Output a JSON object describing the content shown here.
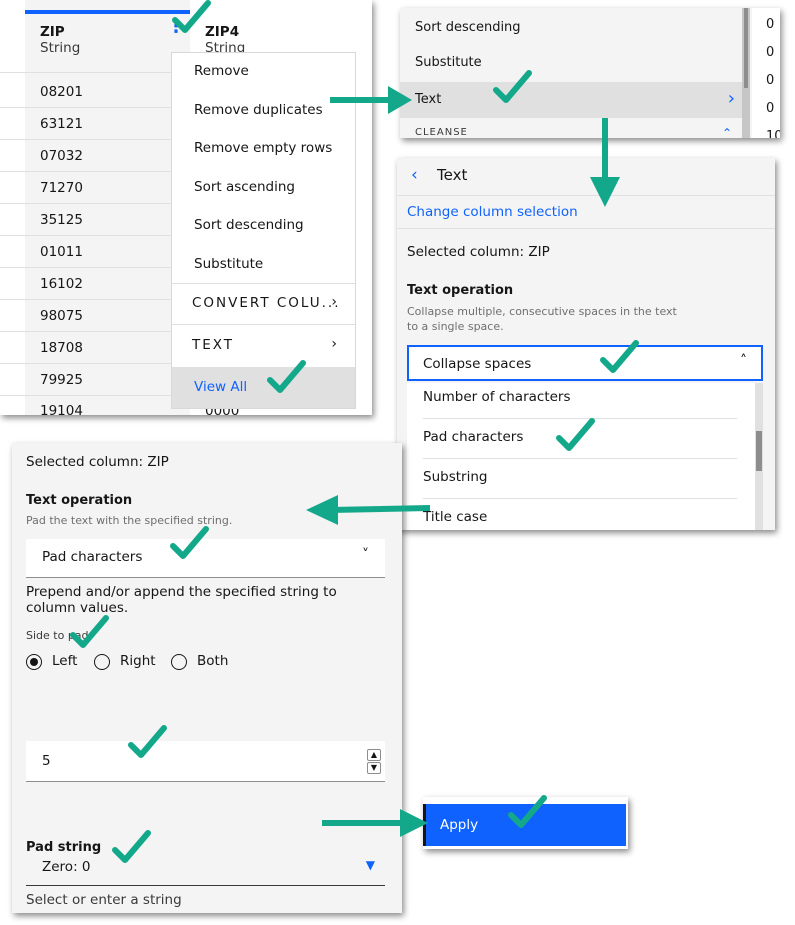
{
  "p1": {
    "zip_header": "ZIP",
    "zip_type": "String",
    "zip4_header": "ZIP4",
    "zip4_type": "String",
    "zip_values": [
      "08201",
      "63121",
      "07032",
      "71270",
      "35125",
      "01011",
      "16102",
      "98075",
      "18708",
      "79925",
      "19104"
    ],
    "zip4_last": "0000",
    "menu": {
      "items": [
        "Remove",
        "Remove duplicates",
        "Remove empty rows",
        "Sort ascending",
        "Sort descending",
        "Substitute"
      ],
      "convert": "CONVERT COLU...",
      "text": "TEXT",
      "view_all": "View All"
    }
  },
  "p2": {
    "items": [
      "Sort descending",
      "Substitute",
      "Text"
    ],
    "cleanse": "CLEANSE",
    "right_values": [
      "0",
      "0",
      "0",
      "0",
      "10"
    ]
  },
  "p3": {
    "title": "Text",
    "change_link": "Change column selection",
    "selected_column": "Selected column: ZIP",
    "op_label": "Text operation",
    "op_desc": "Collapse multiple, consecutive spaces in the text to a single space.",
    "dropdown_value": "Collapse spaces",
    "options": [
      "Number of characters",
      "Pad characters",
      "Substring",
      "Title case"
    ]
  },
  "p4": {
    "selected_column": "Selected column: ZIP",
    "op_label": "Text operation",
    "op_desc": "Pad the text with the specified string.",
    "dropdown_value": "Pad characters",
    "prepend_desc": "Prepend and/or append the specified string to column values.",
    "side_label": "Side to pad",
    "sides": [
      "Left",
      "Right",
      "Both"
    ],
    "number_value": "5",
    "pad_label": "Pad string",
    "pad_value": "Zero: 0",
    "pad_helper": "Select or enter a string"
  },
  "apply": {
    "label": "Apply"
  },
  "colors": {
    "accent": "#0f62fe",
    "check": "#14a88a",
    "link": "#0f62fe"
  }
}
